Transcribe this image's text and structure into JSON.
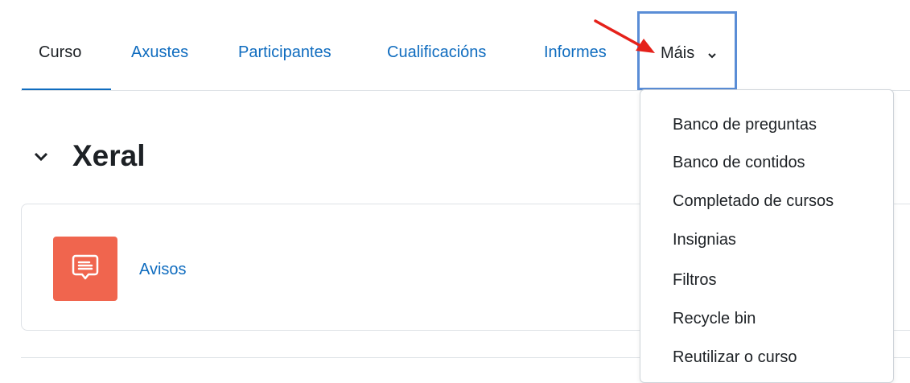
{
  "nav": {
    "tabs": [
      {
        "label": "Curso",
        "active": true
      },
      {
        "label": "Axustes"
      },
      {
        "label": "Participantes"
      },
      {
        "label": "Cualificacións"
      },
      {
        "label": "Informes"
      }
    ],
    "more_label": "Máis",
    "more_icon": "chevron-down-icon",
    "highlight_color": "#5a8dd6",
    "annotation_arrow_color": "#e5211a"
  },
  "dropdown": {
    "items": [
      "Banco de preguntas",
      "Banco de contidos",
      "Completado de cursos",
      "Insignias",
      "Filtros",
      "Recycle bin",
      "Reutilizar o curso"
    ]
  },
  "section": {
    "title": "Xeral",
    "toggle_icon": "chevron-down-icon"
  },
  "activity": {
    "name": "Avisos",
    "icon": "forum-icon",
    "icon_color": "#f0654e"
  },
  "colors": {
    "link": "#0f6cbf",
    "text": "#1d2125",
    "border": "#dee2e6"
  }
}
